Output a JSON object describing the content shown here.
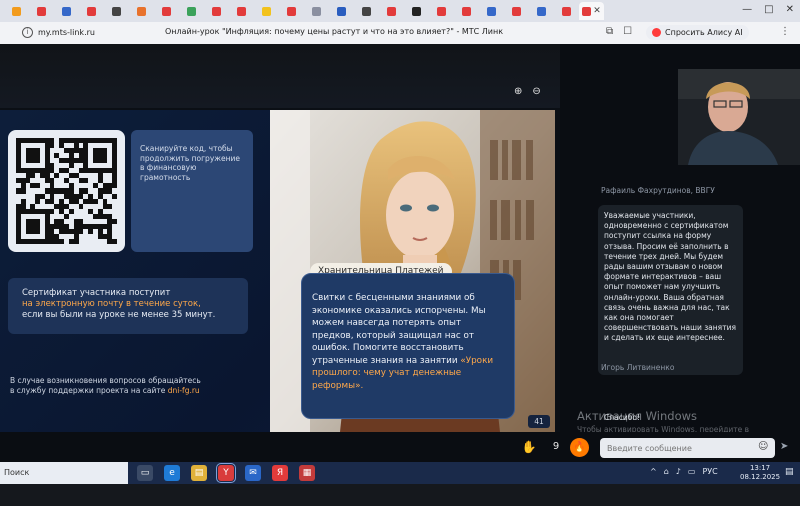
{
  "browser": {
    "url": "my.mts-link.ru",
    "page_title": "Онлайн-урок \"Инфляция: почему цены растут и что на это влияет?\" - МТС Линк",
    "alice_label": "Спросить Алису AI"
  },
  "slide": {
    "scan_text": "Сканируйте код, чтобы продолжить погружение в финансовую грамотность",
    "cert_text_1": "Сертификат участника поступит",
    "cert_text_2": "на электронную почту в течение суток,",
    "cert_text_3": "если вы были на уроке не менее 35 минут.",
    "support_text_1": "В случае возникновения вопросов обращайтесь",
    "support_text_2": "в службу поддержки проекта на сайте",
    "support_link": "dni-fg.ru",
    "keeper_label": "Хранительница Платежей",
    "story_text": "Свитки с бесценными знаниями об экономике оказались испорчены. Мы можем навсегда потерять опыт предков, который защищал нас от ошибок. Помогите восстановить утраченные знания на занятии",
    "story_highlight": "«Уроки прошлого: чему учат денежные реформы».",
    "slide_number": "41"
  },
  "chat": {
    "author1": "Рафаиль Фахрутдинов, ВВГУ",
    "message1": "Уважаемые участники, одновременно с сертификатом поступит ссылка на форму отзыва. Просим её заполнить в течение трех дней. Мы будем рады вашим отзывам о новом формате интерактивов – ваш опыт поможет нам улучшить онлайн-уроки. Ваша обратная связь очень важна для нас, так как она помогает совершенствовать наши занятия и сделать их еще интереснее.",
    "author2": "Игорь Литвиненко",
    "message2": "Спасибо!",
    "input_placeholder": "Введите сообщение",
    "reaction_count": "9"
  },
  "windows_watermark": {
    "title": "Активация Windows",
    "subtitle": "Чтобы активировать Windows, перейдите в раздел \"Параметры\"."
  },
  "taskbar": {
    "search_label": "Поиск",
    "lang": "РУС",
    "time": "13:17",
    "date": "08.12.2025"
  },
  "colors": {
    "accent_orange": "#ffa84a",
    "slide_bg": "#0d1e3a",
    "card_blue": "#2c4775"
  }
}
